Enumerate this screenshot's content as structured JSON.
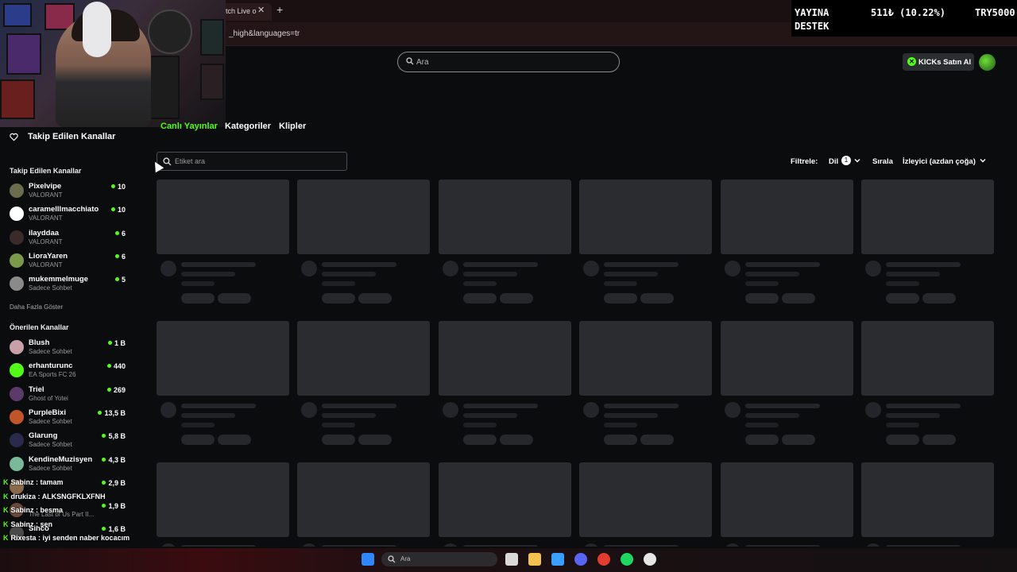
{
  "browser": {
    "tab_title": "tch Live o",
    "url_fragment": "_high&languages=tr"
  },
  "overlay": {
    "line1": "YAYINA",
    "line2": "DESTEK",
    "amount": "511₺ (10.22%)",
    "goal": "TRY5000"
  },
  "header": {
    "search_placeholder": "Ara",
    "buy_kicks_label": "KICKs Satın Al"
  },
  "sidebar": {
    "followed_header": "Takip Edilen Kanallar",
    "followed_section_title": "Takip Edilen Kanallar",
    "followed": [
      {
        "name": "Pixelvipe",
        "category": "VALORANT",
        "viewers": "10",
        "color": "#6b6b4e"
      },
      {
        "name": "caramelllmacchiato",
        "category": "VALORANT",
        "viewers": "10",
        "color": "#ffffff"
      },
      {
        "name": "ilayddaa",
        "category": "VALORANT",
        "viewers": "6",
        "color": "#3b2a2a"
      },
      {
        "name": "LioraYaren",
        "category": "VALORANT",
        "viewers": "6",
        "color": "#7a9a4a"
      },
      {
        "name": "mukemmelmuge",
        "category": "Sadece Sohbet",
        "viewers": "5",
        "color": "#8a8a8a"
      }
    ],
    "show_more": "Daha Fazla Göster",
    "recommended_title": "Önerilen Kanallar",
    "recommended": [
      {
        "name": "Blush",
        "category": "Sadece Sohbet",
        "viewers": "1 B",
        "color": "#c8a0a8"
      },
      {
        "name": "erhanturunc",
        "category": "EA Sports FC 26",
        "viewers": "440",
        "color": "#53fc18"
      },
      {
        "name": "Triel",
        "category": "Ghost of Yotei",
        "viewers": "269",
        "color": "#5a3a6a"
      },
      {
        "name": "PurpleBixi",
        "category": "Sadece Sohbet",
        "viewers": "13,5 B",
        "color": "#c0552a"
      },
      {
        "name": "Glarung",
        "category": "Sadece Sohbet",
        "viewers": "5,8 B",
        "color": "#2a2a4a"
      },
      {
        "name": "KendineMuzisyen",
        "category": "Sadece Sohbet",
        "viewers": "4,3 B",
        "color": "#7ab89a"
      },
      {
        "name": "",
        "category": "",
        "viewers": "2,9 B",
        "color": "#8a6a4a"
      },
      {
        "name": "",
        "category": "The Last of Us Part II...",
        "viewers": "1,9 B",
        "color": "#6a4a3a"
      },
      {
        "name": "Sinco",
        "category": "",
        "viewers": "1,6 B",
        "color": "#4a4a4a"
      }
    ]
  },
  "chat": [
    {
      "user": "Sabinz",
      "text": "tamam"
    },
    {
      "user": "drukiza",
      "text": "ALKSNGFKLXFNH"
    },
    {
      "user": "Sabinz",
      "text": "besma"
    },
    {
      "user": "Sabinz",
      "text": "sen"
    },
    {
      "user": "Rixesta",
      "text": "iyi senden naber kocacım"
    }
  ],
  "main": {
    "tabs": [
      "Canlı Yayınlar",
      "Kategoriler",
      "Klipler"
    ],
    "tag_search_placeholder": "Etiket ara",
    "filter_label": "Filtrele:",
    "language_label": "Dil",
    "language_count": "1",
    "sort_label": "Sırala",
    "sort_value": "İzleyici (azdan çoğa)"
  },
  "taskbar": {
    "search_placeholder": "Ara",
    "icons": [
      "windows-icon",
      "file-explorer-icon",
      "folder-icon",
      "store-icon",
      "discord-icon",
      "chrome-icon",
      "spotify-icon",
      "obs-icon"
    ]
  },
  "colors": {
    "accent": "#53fc18",
    "background": "#0b0c0d",
    "skeleton": "#2a2c30"
  }
}
